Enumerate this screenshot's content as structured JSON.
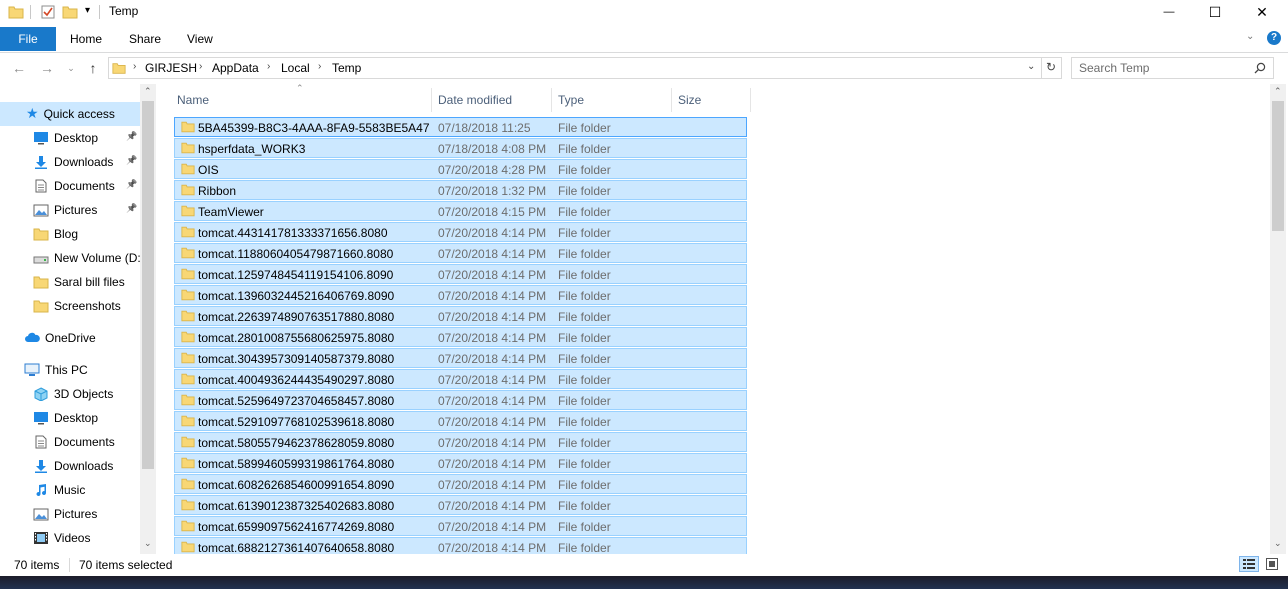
{
  "window": {
    "title": "Temp",
    "minimize_glyph": "—",
    "maximize_glyph": "☐",
    "close_glyph": "✕"
  },
  "ribbon": {
    "tabs": [
      "File",
      "Home",
      "Share",
      "View"
    ],
    "help_glyph": "?"
  },
  "address": {
    "crumbs": [
      "GIRJESH",
      "AppData",
      "Local",
      "Temp"
    ],
    "search_placeholder": "Search Temp"
  },
  "nav_pane": {
    "quick_access": "Quick access",
    "quick_items": [
      {
        "label": "Desktop",
        "icon": "desktop-icon",
        "pinned": true
      },
      {
        "label": "Downloads",
        "icon": "downloads-icon",
        "pinned": true
      },
      {
        "label": "Documents",
        "icon": "documents-icon",
        "pinned": true
      },
      {
        "label": "Pictures",
        "icon": "pictures-icon",
        "pinned": true
      },
      {
        "label": "Blog",
        "icon": "folder-icon",
        "pinned": false
      },
      {
        "label": "New Volume (D:",
        "icon": "drive-icon",
        "pinned": false
      },
      {
        "label": "Saral bill files",
        "icon": "folder-icon",
        "pinned": false
      },
      {
        "label": "Screenshots",
        "icon": "folder-icon",
        "pinned": false
      }
    ],
    "onedrive": "OneDrive",
    "this_pc": "This PC",
    "pc_items": [
      {
        "label": "3D Objects",
        "icon": "3d-objects-icon"
      },
      {
        "label": "Desktop",
        "icon": "desktop-icon"
      },
      {
        "label": "Documents",
        "icon": "documents-icon"
      },
      {
        "label": "Downloads",
        "icon": "downloads-icon"
      },
      {
        "label": "Music",
        "icon": "music-icon"
      },
      {
        "label": "Pictures",
        "icon": "pictures-icon"
      },
      {
        "label": "Videos",
        "icon": "videos-icon"
      }
    ]
  },
  "columns": {
    "name": "Name",
    "date": "Date modified",
    "type": "Type",
    "size": "Size"
  },
  "files": [
    {
      "name": "5BA45399-B8C3-4AAA-8FA9-5583BE5A47",
      "date": "07/18/2018 11:25",
      "type": "File folder"
    },
    {
      "name": "hsperfdata_WORK3",
      "date": "07/18/2018 4:08 PM",
      "type": "File folder"
    },
    {
      "name": "OIS",
      "date": "07/20/2018 4:28 PM",
      "type": "File folder"
    },
    {
      "name": "Ribbon",
      "date": "07/20/2018 1:32 PM",
      "type": "File folder"
    },
    {
      "name": "TeamViewer",
      "date": "07/20/2018 4:15 PM",
      "type": "File folder"
    },
    {
      "name": "tomcat.443141781333371656.8080",
      "date": "07/20/2018 4:14 PM",
      "type": "File folder"
    },
    {
      "name": "tomcat.1188060405479871660.8080",
      "date": "07/20/2018 4:14 PM",
      "type": "File folder"
    },
    {
      "name": "tomcat.1259748454119154106.8090",
      "date": "07/20/2018 4:14 PM",
      "type": "File folder"
    },
    {
      "name": "tomcat.1396032445216406769.8090",
      "date": "07/20/2018 4:14 PM",
      "type": "File folder"
    },
    {
      "name": "tomcat.2263974890763517880.8080",
      "date": "07/20/2018 4:14 PM",
      "type": "File folder"
    },
    {
      "name": "tomcat.2801008755680625975.8080",
      "date": "07/20/2018 4:14 PM",
      "type": "File folder"
    },
    {
      "name": "tomcat.3043957309140587379.8080",
      "date": "07/20/2018 4:14 PM",
      "type": "File folder"
    },
    {
      "name": "tomcat.4004936244435490297.8080",
      "date": "07/20/2018 4:14 PM",
      "type": "File folder"
    },
    {
      "name": "tomcat.5259649723704658457.8080",
      "date": "07/20/2018 4:14 PM",
      "type": "File folder"
    },
    {
      "name": "tomcat.5291097768102539618.8080",
      "date": "07/20/2018 4:14 PM",
      "type": "File folder"
    },
    {
      "name": "tomcat.5805579462378628059.8080",
      "date": "07/20/2018 4:14 PM",
      "type": "File folder"
    },
    {
      "name": "tomcat.5899460599319861764.8080",
      "date": "07/20/2018 4:14 PM",
      "type": "File folder"
    },
    {
      "name": "tomcat.6082626854600991654.8090",
      "date": "07/20/2018 4:14 PM",
      "type": "File folder"
    },
    {
      "name": "tomcat.6139012387325402683.8080",
      "date": "07/20/2018 4:14 PM",
      "type": "File folder"
    },
    {
      "name": "tomcat.6599097562416774269.8080",
      "date": "07/20/2018 4:14 PM",
      "type": "File folder"
    },
    {
      "name": "tomcat.6882127361407640658.8080",
      "date": "07/20/2018 4:14 PM",
      "type": "File folder"
    }
  ],
  "status": {
    "item_count": "70 items",
    "selected_count": "70 items selected"
  },
  "colors": {
    "accent": "#1979ca",
    "selection_fill": "#cce8ff",
    "selection_border": "#99d1ff",
    "folder": "#f8d775"
  }
}
